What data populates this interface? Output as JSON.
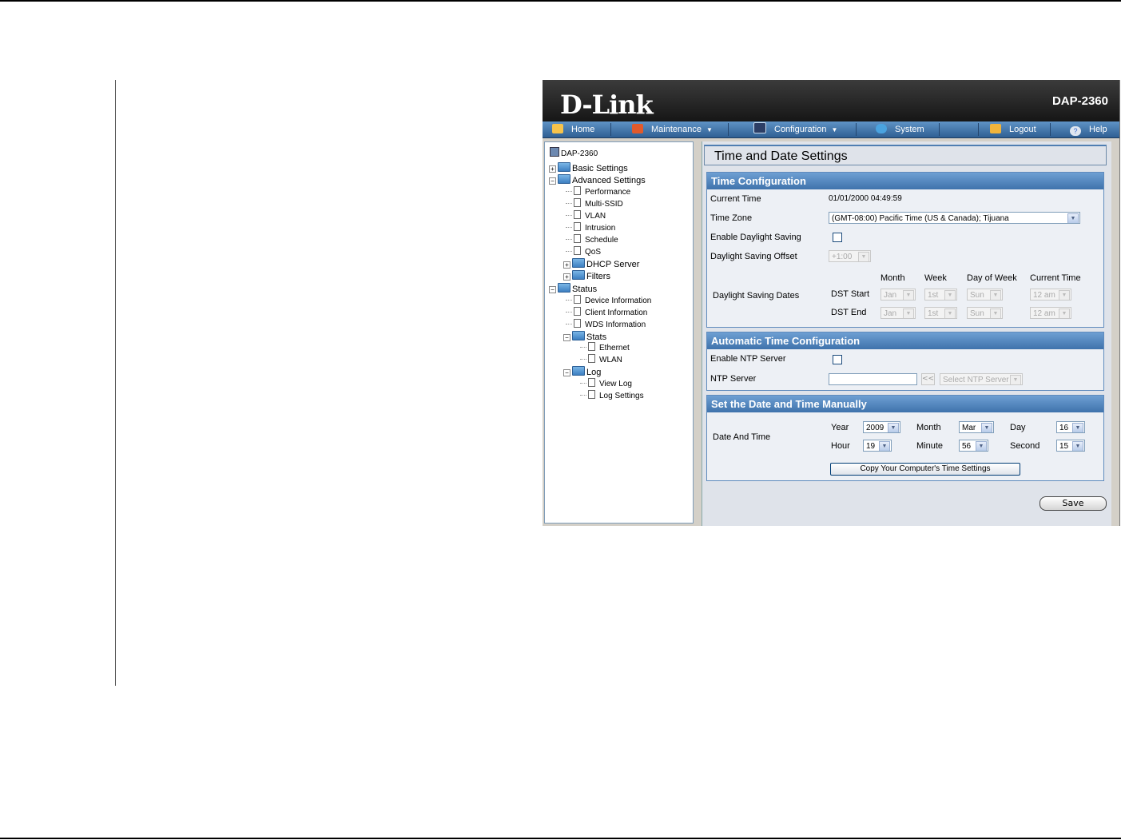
{
  "app": {
    "logo": "D-Link",
    "model": "DAP-2360"
  },
  "menu": {
    "home": "Home",
    "maintenance": "Maintenance",
    "configuration": "Configuration",
    "system": "System",
    "logout": "Logout",
    "help": "Help"
  },
  "tree": {
    "root": "DAP-2360",
    "basic": "Basic Settings",
    "advanced": "Advanced Settings",
    "performance": "Performance",
    "multissid": "Multi-SSID",
    "vlan": "VLAN",
    "intrusion": "Intrusion",
    "schedule": "Schedule",
    "qos": "QoS",
    "dhcp": "DHCP Server",
    "filters": "Filters",
    "status": "Status",
    "device": "Device Information",
    "client": "Client Information",
    "wds": "WDS Information",
    "stats": "Stats",
    "ethernet": "Ethernet",
    "wlan": "WLAN",
    "log": "Log",
    "viewlog": "View Log",
    "logsettings": "Log Settings"
  },
  "page": {
    "title": "Time and Date Settings"
  },
  "timecfg": {
    "header": "Time Configuration",
    "current_time_label": "Current Time",
    "current_time_value": "01/01/2000 04:49:59",
    "timezone_label": "Time Zone",
    "timezone_value": "(GMT-08:00) Pacific Time (US & Canada); Tijuana",
    "dst_enable_label": "Enable Daylight Saving",
    "dst_offset_label": "Daylight Saving Offset",
    "dst_offset_value": "+1:00",
    "dst_dates_label": "Daylight Saving Dates",
    "col_month": "Month",
    "col_week": "Week",
    "col_dow": "Day of Week",
    "col_time": "Current Time",
    "dst_start": "DST Start",
    "dst_end": "DST End",
    "start_month": "Jan",
    "start_week": "1st",
    "start_dow": "Sun",
    "start_time": "12 am",
    "end_month": "Jan",
    "end_week": "1st",
    "end_dow": "Sun",
    "end_time": "12 am"
  },
  "ntp": {
    "header": "Automatic Time Configuration",
    "enable_label": "Enable NTP Server",
    "server_label": "NTP Server",
    "server_value": "",
    "arrow": "<<",
    "select_placeholder": "Select NTP Server"
  },
  "manual": {
    "header": "Set the Date and Time Manually",
    "label": "Date And Time",
    "year_label": "Year",
    "year": "2009",
    "month_label": "Month",
    "month": "Mar",
    "day_label": "Day",
    "day": "16",
    "hour_label": "Hour",
    "hour": "19",
    "minute_label": "Minute",
    "minute": "56",
    "second_label": "Second",
    "second": "15",
    "copy_button": "Copy Your Computer's Time Settings"
  },
  "save_button": "Save",
  "colors": {
    "menubar": "#3b6ea5",
    "section_header": "#4f82bb",
    "banner": "#262626"
  },
  "icons": [
    "home-icon",
    "tools-icon",
    "disk-icon",
    "globe-icon",
    "key-icon",
    "help-icon",
    "folder-icon",
    "document-icon",
    "computer-icon"
  ]
}
